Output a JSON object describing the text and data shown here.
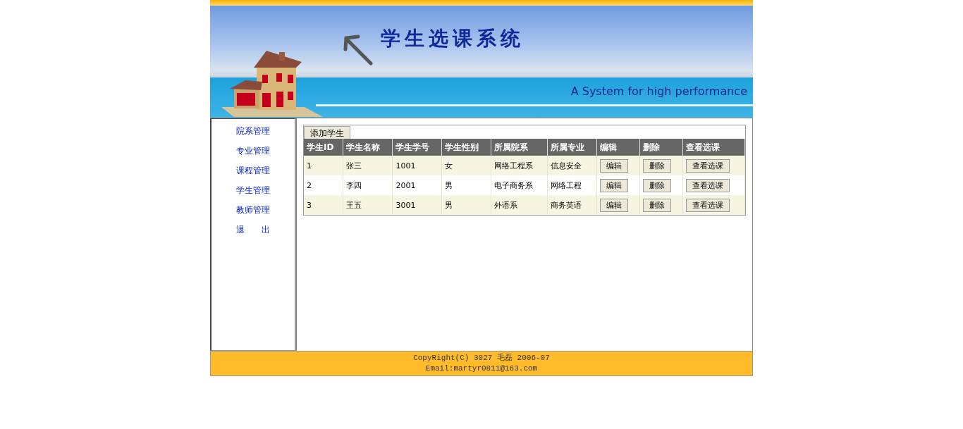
{
  "banner": {
    "title": "学生选课系统",
    "subtitle": "A System for high performance"
  },
  "sidebar": {
    "items": [
      {
        "label": "院系管理"
      },
      {
        "label": "专业管理"
      },
      {
        "label": "课程管理"
      },
      {
        "label": "学生管理"
      },
      {
        "label": "教师管理"
      },
      {
        "label": "退　　出"
      }
    ]
  },
  "toolbar": {
    "add_button": "添加学生"
  },
  "table": {
    "columns": [
      "学生ID",
      "学生名称",
      "学生学号",
      "学生性别",
      "所属院系",
      "所属专业",
      "编辑",
      "删除",
      "查看选课"
    ],
    "rows": [
      {
        "cells": [
          "1",
          "张三",
          "1001",
          "女",
          "网络工程系",
          "信息安全"
        ],
        "actions": [
          "编辑",
          "删除",
          "查看选课"
        ]
      },
      {
        "cells": [
          "2",
          "李四",
          "2001",
          "男",
          "电子商务系",
          "网络工程"
        ],
        "actions": [
          "编辑",
          "删除",
          "查看选课"
        ]
      },
      {
        "cells": [
          "3",
          "王五",
          "3001",
          "男",
          "外语系",
          "商务英语"
        ],
        "actions": [
          "编辑",
          "删除",
          "查看选课"
        ]
      }
    ]
  },
  "footer": {
    "copyright": "CopyRight(C) 3027 毛磊 2006-07",
    "email": "Email:martyr0811@163.com"
  }
}
